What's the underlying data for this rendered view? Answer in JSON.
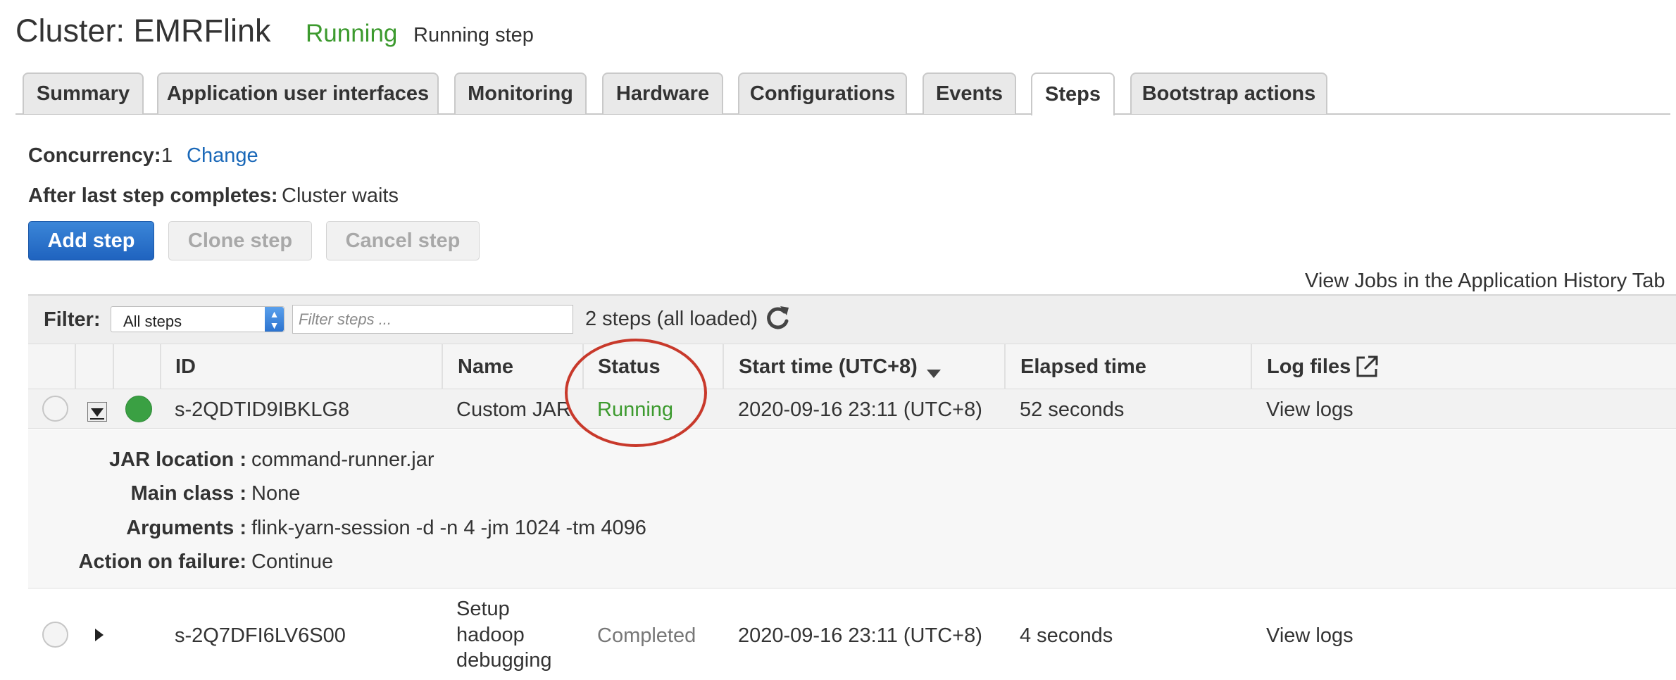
{
  "header": {
    "title": "Cluster: EMRFlink",
    "state": "Running",
    "substate": "Running step"
  },
  "tabs": [
    {
      "label": "Summary"
    },
    {
      "label": "Application user interfaces"
    },
    {
      "label": "Monitoring"
    },
    {
      "label": "Hardware"
    },
    {
      "label": "Configurations"
    },
    {
      "label": "Events"
    },
    {
      "label": "Steps"
    },
    {
      "label": "Bootstrap actions"
    }
  ],
  "active_tab": "Steps",
  "concurrency": {
    "label": "Concurrency:",
    "value": "1",
    "change_link": "Change"
  },
  "after_last_step": {
    "label": "After last step completes:",
    "value": "Cluster waits"
  },
  "buttons": {
    "add": "Add step",
    "clone": "Clone step",
    "cancel": "Cancel step"
  },
  "history_link": "View Jobs in the Application History Tab",
  "filter": {
    "label": "Filter:",
    "selected": "All steps",
    "placeholder": "Filter steps ...",
    "count_text": "2 steps (all loaded)"
  },
  "columns": {
    "id": "ID",
    "name": "Name",
    "status": "Status",
    "start_time": "Start time (UTC+8)",
    "elapsed": "Elapsed time",
    "log_files": "Log files"
  },
  "steps": [
    {
      "id": "s-2QDTID9IBKLG8",
      "name": "Custom JAR",
      "status": "Running",
      "start_time": "2020-09-16 23:11 (UTC+8)",
      "elapsed": "52 seconds",
      "logs": "View logs",
      "details": {
        "jar_label": "JAR location :",
        "jar_value": "command-runner.jar",
        "main_label": "Main class :",
        "main_value": "None",
        "args_label": "Arguments :",
        "args_value": "flink-yarn-session -d -n 4 -jm 1024 -tm 4096",
        "failure_label": "Action on failure:",
        "failure_value": "Continue"
      }
    },
    {
      "id": "s-2Q7DFI6LV6S00",
      "name_lines": [
        "Setup",
        "hadoop",
        "debugging"
      ],
      "status": "Completed",
      "start_time": "2020-09-16 23:11 (UTC+8)",
      "elapsed": "4 seconds",
      "logs": "View logs"
    }
  ],
  "colors": {
    "running": "#3c9a2e",
    "link": "#1a68b8",
    "primary_button": "#1f63bf",
    "annotation_circle": "#c8392b"
  }
}
